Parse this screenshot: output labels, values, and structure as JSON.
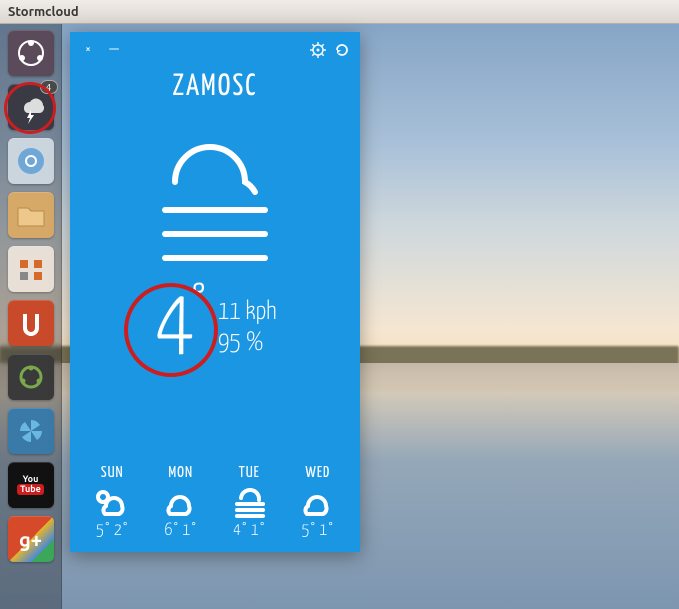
{
  "window": {
    "title": "Stormcloud"
  },
  "launcher": {
    "items": [
      {
        "name": "dash-icon",
        "badge": null
      },
      {
        "name": "stormcloud-icon",
        "badge": "4"
      },
      {
        "name": "chromium-icon",
        "badge": null
      },
      {
        "name": "files-icon",
        "badge": null
      },
      {
        "name": "system-settings-icon",
        "badge": null
      },
      {
        "name": "ubuntu-one-icon",
        "badge": null
      },
      {
        "name": "software-center-icon",
        "badge": null
      },
      {
        "name": "shutter-icon",
        "badge": null
      },
      {
        "name": "youtube-icon",
        "badge": null
      },
      {
        "name": "google-plus-icon",
        "badge": null
      }
    ]
  },
  "weather": {
    "city": "ZAMOSC",
    "temperature": "4",
    "degree": "°",
    "wind": "11 kph",
    "humidity": "95 %",
    "forecast": [
      {
        "day": "SUN",
        "icon": "partly-cloudy",
        "hi": "5°",
        "lo": "2°"
      },
      {
        "day": "MON",
        "icon": "cloudy",
        "hi": "6°",
        "lo": "1°"
      },
      {
        "day": "TUE",
        "icon": "fog",
        "hi": "4°",
        "lo": "1°"
      },
      {
        "day": "WED",
        "icon": "cloudy",
        "hi": "5°",
        "lo": "1°"
      }
    ]
  },
  "controls": {
    "close": "×",
    "minimize": "—"
  }
}
